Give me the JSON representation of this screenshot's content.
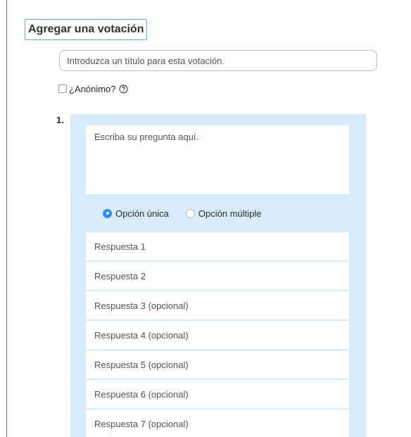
{
  "header": {
    "title": "Agregar una votación"
  },
  "poll": {
    "title_placeholder": "Introduzca un título para esta votación.",
    "anonymous_label": "¿Anónimo?",
    "help_icon": "question-circle-icon"
  },
  "question": {
    "number": "1.",
    "placeholder": "Escriba su pregunta aquí.",
    "type_options": [
      {
        "label": "Opción única",
        "selected": true
      },
      {
        "label": "Opción múltiple",
        "selected": false
      }
    ],
    "answers": [
      {
        "placeholder": "Respuesta 1"
      },
      {
        "placeholder": "Respuesta 2"
      },
      {
        "placeholder": "Respuesta 3 (opcional)"
      },
      {
        "placeholder": "Respuesta 4 (opcional)"
      },
      {
        "placeholder": "Respuesta 5 (opcional)"
      },
      {
        "placeholder": "Respuesta 6 (opcional)"
      },
      {
        "placeholder": "Respuesta 7 (opcional)"
      }
    ]
  },
  "colors": {
    "accent": "#2d8cff",
    "panel_bg": "#d7ecfc",
    "title_border": "#6aa2f0"
  }
}
